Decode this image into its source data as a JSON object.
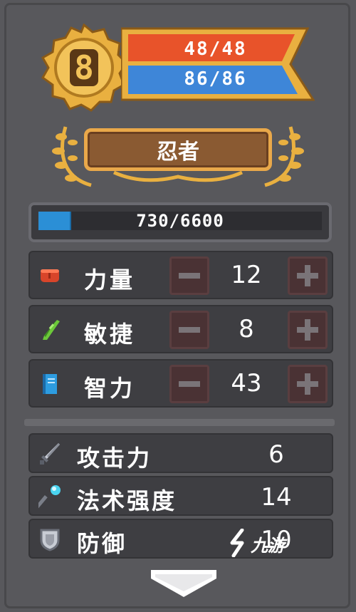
{
  "header": {
    "level": "8",
    "hp": "48/48",
    "mp": "86/86"
  },
  "character": {
    "class_name": "忍者"
  },
  "experience": {
    "text": "730/6600",
    "progress_fraction": 0.11
  },
  "attributes": [
    {
      "label": "力量",
      "value": "12",
      "icon": "fist-icon"
    },
    {
      "label": "敏捷",
      "value": "8",
      "icon": "feather-icon"
    },
    {
      "label": "智力",
      "value": "43",
      "icon": "book-icon"
    }
  ],
  "stats": [
    {
      "label": "攻击力",
      "value": "6",
      "icon": "sword-icon"
    },
    {
      "label": "法术强度",
      "value": "14",
      "icon": "wand-icon"
    },
    {
      "label": "防御",
      "value": "10",
      "icon": "shield-icon"
    }
  ],
  "watermark": {
    "text": "九游"
  },
  "colors": {
    "hp": "#e8532a",
    "mp": "#3e86d8",
    "gold": "#e9b040",
    "xp": "#2b8fd6"
  }
}
